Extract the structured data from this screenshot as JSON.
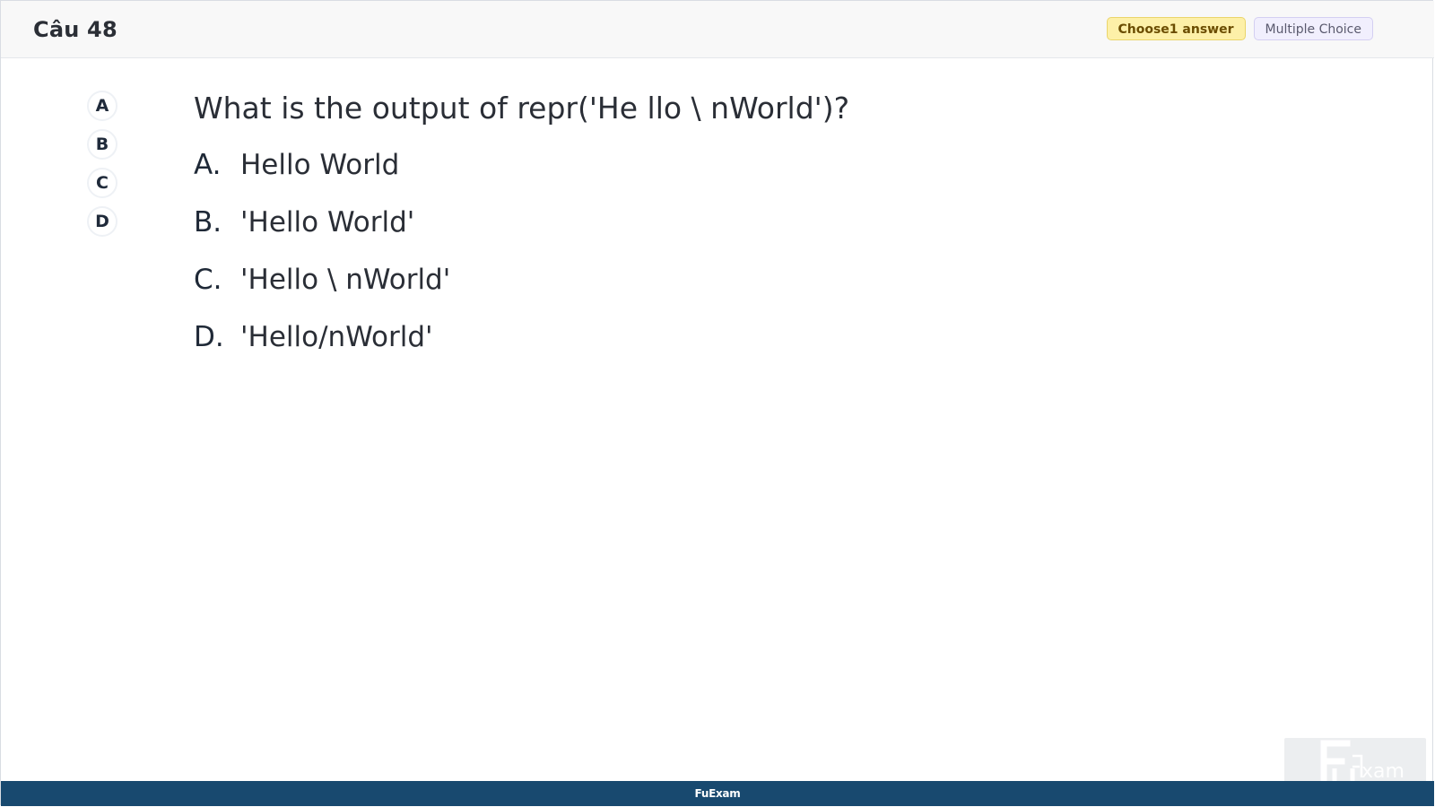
{
  "header": {
    "title": "Câu 48",
    "badge_choose": "Choose1 answer",
    "badge_type": "Multiple Choice"
  },
  "answer_nav": [
    "A",
    "B",
    "C",
    "D"
  ],
  "question": {
    "text": "What is the output of repr('He llo \\ nWorld')?",
    "options": [
      {
        "letter": "A.",
        "text": "Hello World"
      },
      {
        "letter": "B.",
        "text": "'Hello World'"
      },
      {
        "letter": "C.",
        "text": "'Hello \\ nWorld'"
      },
      {
        "letter": "D.",
        "text": "'Hello/nWorld'"
      }
    ]
  },
  "footer": {
    "text": "FuExam"
  },
  "watermark": {
    "text": "FUExam"
  },
  "colors": {
    "footer_bg": "#18496f",
    "choose_badge_bg": "#fdf0a8",
    "type_badge_bg": "#f1effd"
  }
}
